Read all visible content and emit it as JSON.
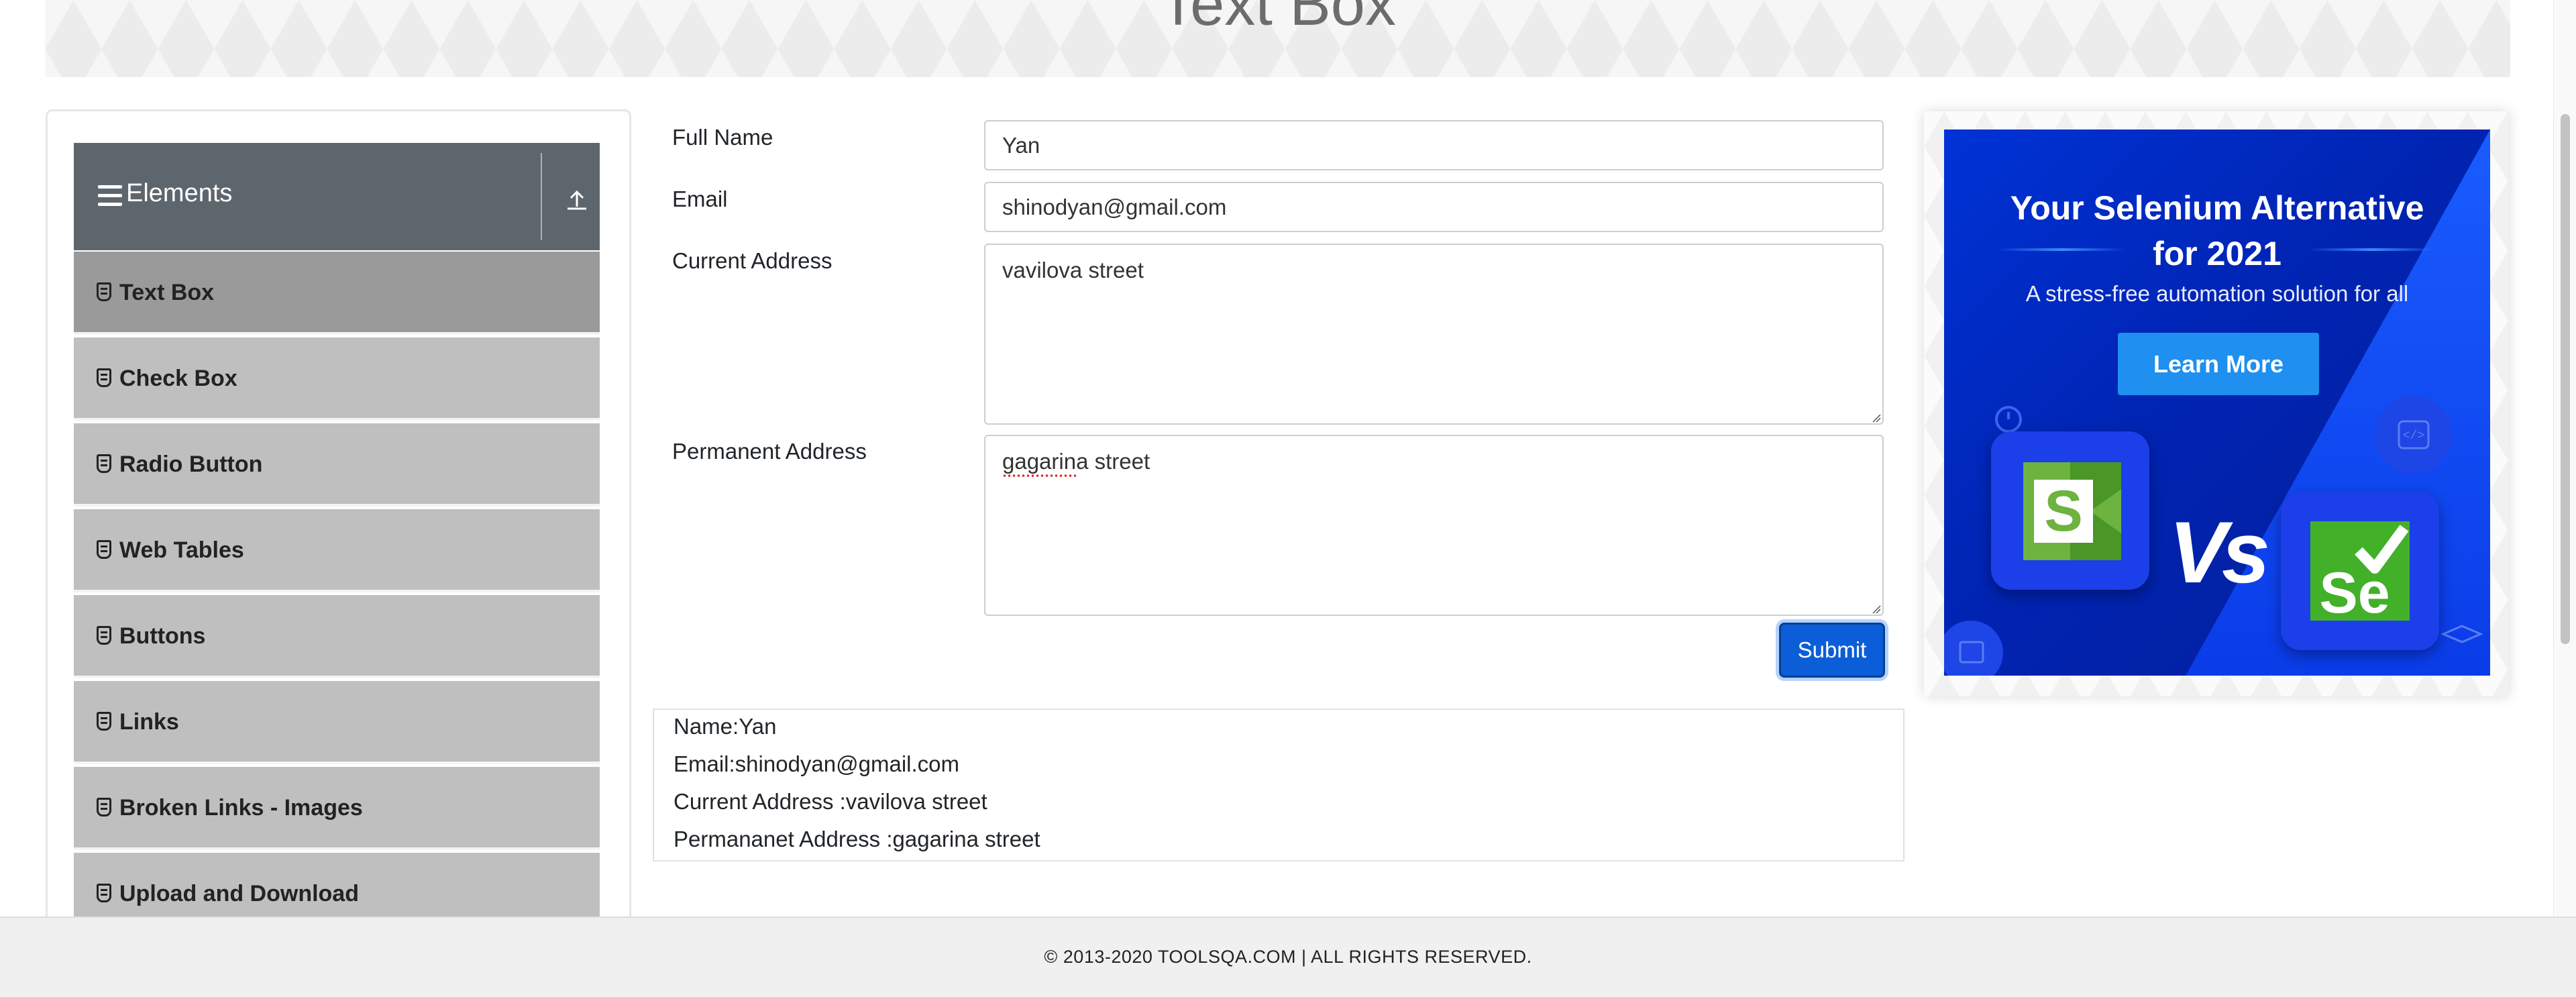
{
  "page": {
    "title": "Text Box"
  },
  "sidebar": {
    "group_title": "Elements",
    "items": [
      {
        "label": "Text Box",
        "active": true
      },
      {
        "label": "Check Box",
        "active": false
      },
      {
        "label": "Radio Button",
        "active": false
      },
      {
        "label": "Web Tables",
        "active": false
      },
      {
        "label": "Buttons",
        "active": false
      },
      {
        "label": "Links",
        "active": false
      },
      {
        "label": "Broken Links - Images",
        "active": false
      },
      {
        "label": "Upload and Download",
        "active": false
      }
    ]
  },
  "form": {
    "full_name": {
      "label": "Full Name",
      "value": "Yan"
    },
    "email": {
      "label": "Email",
      "value": "shinodyan@gmail.com"
    },
    "current_address": {
      "label": "Current Address",
      "value": "vavilova street"
    },
    "permanent_address": {
      "label": "Permanent Address",
      "value": "gagarina street"
    },
    "submit_label": "Submit"
  },
  "output": {
    "name": "Name:Yan",
    "email": "Email:shinodyan@gmail.com",
    "current_address": "Current Address :vavilova street",
    "permanent_address": "Permananet Address :gagarina street"
  },
  "ad": {
    "title_line1": "Your Selenium Alternative",
    "title_line2": "for 2021",
    "subtitle": "A stress-free automation solution for all",
    "button": "Learn More",
    "vs": "Vs",
    "logo_left_letter": "S",
    "logo_right_letters": "Se"
  },
  "footer": {
    "text": "© 2013-2020 TOOLSQA.COM | ALL RIGHTS RESERVED."
  },
  "colors": {
    "sidebar_header": "#5e666d",
    "menu_item": "#bfbfbf",
    "menu_item_active": "#9a9a9a",
    "primary_button": "#0b5ed7",
    "ad_background": "#0033d6",
    "ad_button": "#1f8ff0",
    "logo_green": "#6db33f"
  },
  "icons": {
    "menu": "hamburger-icon",
    "collapse": "upload-arrow-icon",
    "item": "html5-shield-icon"
  }
}
